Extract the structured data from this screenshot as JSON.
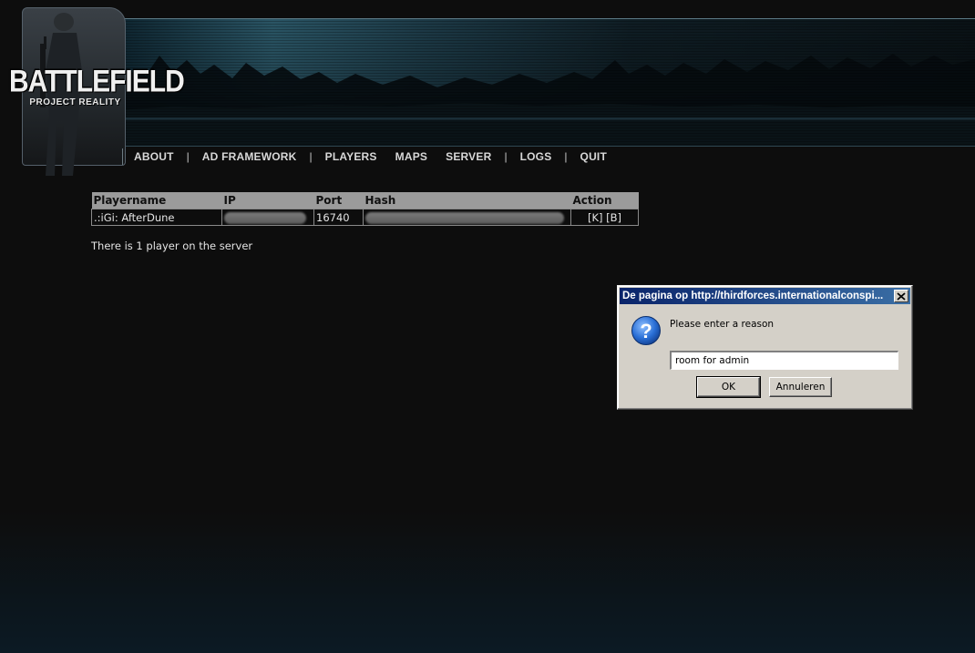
{
  "logo": {
    "main": "BATTLEFIELD",
    "sub": "PROJECT REALITY"
  },
  "nav": {
    "items": [
      {
        "label": "ABOUT"
      },
      {
        "label": "AD FRAMEWORK"
      },
      {
        "label": "PLAYERS"
      },
      {
        "label": "MAPS"
      },
      {
        "label": "SERVER"
      },
      {
        "label": "LOGS"
      },
      {
        "label": "QUIT"
      }
    ]
  },
  "players_table": {
    "headers": [
      "Playername",
      "IP",
      "Port",
      "Hash",
      "Action"
    ],
    "rows": [
      {
        "name": ".:iGi: AfterDune",
        "port": "16740",
        "actions": "[K] [B]"
      }
    ]
  },
  "player_count_text": "There is 1 player on the server",
  "dialog": {
    "title": "De pagina op http://thirdforces.internationalconspi...",
    "message": "Please enter a reason",
    "input_value": "room for admin",
    "ok_label": "OK",
    "cancel_label": "Annuleren"
  },
  "colors": {
    "page_bg": "#0d0d0d",
    "table_header_bg": "#9b9b9b",
    "dialog_bg": "#d4d0c8",
    "titlebar_start": "#0a246a",
    "titlebar_end": "#3a6ea5"
  }
}
